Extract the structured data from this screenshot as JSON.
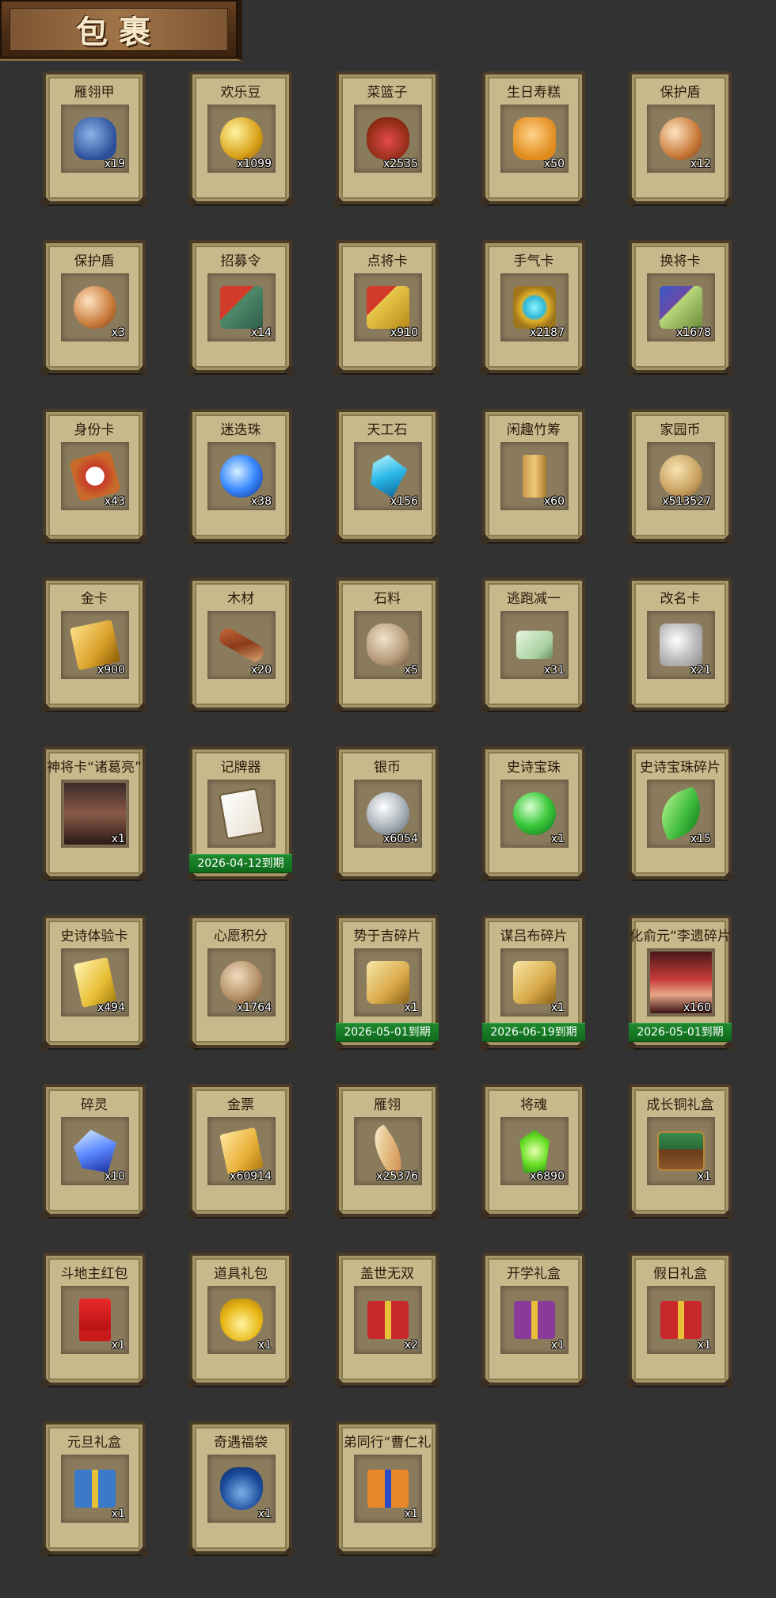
{
  "header": {
    "title": "包裹"
  },
  "items": [
    {
      "name": "雁翎甲",
      "qty": "x19",
      "icon": "armor-icon",
      "style": "i-armor",
      "expiry": ""
    },
    {
      "name": "欢乐豆",
      "qty": "x1099",
      "icon": "gold-beans-icon",
      "style": "i-coin",
      "expiry": ""
    },
    {
      "name": "菜篮子",
      "qty": "x2535",
      "icon": "vegetable-basket-icon",
      "style": "i-basket",
      "expiry": ""
    },
    {
      "name": "生日寿糕",
      "qty": "x50",
      "icon": "birthday-cake-icon",
      "style": "i-cake",
      "expiry": ""
    },
    {
      "name": "保护盾",
      "qty": "x12",
      "icon": "shield-icon",
      "style": "i-shield",
      "expiry": ""
    },
    {
      "name": "保护盾",
      "qty": "x3",
      "icon": "shield-icon",
      "style": "i-shield",
      "expiry": ""
    },
    {
      "name": "招募令",
      "qty": "x14",
      "icon": "recruit-order-icon",
      "style": "i-flag-red",
      "expiry": ""
    },
    {
      "name": "点将卡",
      "qty": "x910",
      "icon": "general-card-icon",
      "style": "i-ticket",
      "expiry": ""
    },
    {
      "name": "手气卡",
      "qty": "x2187",
      "icon": "luck-card-icon",
      "style": "i-ring",
      "expiry": ""
    },
    {
      "name": "换将卡",
      "qty": "x1678",
      "icon": "swap-card-icon",
      "style": "i-swap",
      "expiry": ""
    },
    {
      "name": "身份卡",
      "qty": "x43",
      "icon": "identity-card-icon",
      "style": "i-mask",
      "expiry": ""
    },
    {
      "name": "迷迭珠",
      "qty": "x38",
      "icon": "blue-orb-icon",
      "style": "i-orb-blue",
      "expiry": ""
    },
    {
      "name": "天工石",
      "qty": "x156",
      "icon": "cyan-crystal-icon",
      "style": "i-crystal-cyan",
      "expiry": ""
    },
    {
      "name": "闲趣竹筹",
      "qty": "x60",
      "icon": "bamboo-tally-icon",
      "style": "i-bamboo",
      "expiry": ""
    },
    {
      "name": "家园币",
      "qty": "x513527",
      "icon": "home-coin-icon",
      "style": "i-token",
      "expiry": ""
    },
    {
      "name": "金卡",
      "qty": "x900",
      "icon": "gold-card-icon",
      "style": "i-gold-card",
      "expiry": ""
    },
    {
      "name": "木材",
      "qty": "x20",
      "icon": "wood-icon",
      "style": "i-wood",
      "expiry": ""
    },
    {
      "name": "石料",
      "qty": "x5",
      "icon": "stone-icon",
      "style": "i-stone",
      "expiry": ""
    },
    {
      "name": "逃跑减一",
      "qty": "x31",
      "icon": "jade-tag-icon",
      "style": "i-jade-tag",
      "expiry": ""
    },
    {
      "name": "改名卡",
      "qty": "x21",
      "icon": "rename-card-icon",
      "style": "i-rename",
      "expiry": ""
    },
    {
      "name": "神将卡“诸葛亮”",
      "qty": "x1",
      "icon": "hero-portrait-icon",
      "style": "i-portrait",
      "expiry": ""
    },
    {
      "name": "记牌器",
      "qty": "",
      "icon": "card-counter-icon",
      "style": "i-cards",
      "expiry": "2026-04-12到期"
    },
    {
      "name": "银币",
      "qty": "x6054",
      "icon": "silver-coin-icon",
      "style": "i-silver",
      "expiry": ""
    },
    {
      "name": "史诗宝珠",
      "qty": "x1",
      "icon": "green-orb-icon",
      "style": "i-orb-green",
      "expiry": ""
    },
    {
      "name": "史诗宝珠碎片",
      "qty": "x15",
      "icon": "green-shard-icon",
      "style": "i-leaf-green",
      "expiry": ""
    },
    {
      "name": "史诗体验卡",
      "qty": "x494",
      "icon": "gold-experience-card-icon",
      "style": "i-gold-scroll",
      "expiry": ""
    },
    {
      "name": "心愿积分",
      "qty": "x1764",
      "icon": "heart-coin-icon",
      "style": "i-heart-coin",
      "expiry": ""
    },
    {
      "name": "势于吉碎片",
      "qty": "x1",
      "icon": "puzzle-piece-icon",
      "style": "i-puzzle",
      "expiry": "2026-05-01到期"
    },
    {
      "name": "谋吕布碎片",
      "qty": "x1",
      "icon": "puzzle-piece-icon",
      "style": "i-puzzle",
      "expiry": "2026-06-19到期"
    },
    {
      "name": "化俞元“李遗碎片",
      "qty": "x160",
      "icon": "hero-portrait-icon",
      "style": "i-hero-red",
      "expiry": "2026-05-01到期"
    },
    {
      "name": "碎灵",
      "qty": "x10",
      "icon": "blue-crystal-icon",
      "style": "i-crystal-blue",
      "expiry": ""
    },
    {
      "name": "金票",
      "qty": "x60914",
      "icon": "gold-ticket-icon",
      "style": "i-gold-note",
      "expiry": ""
    },
    {
      "name": "雁翎",
      "qty": "x25376",
      "icon": "feather-icon",
      "style": "i-feather",
      "expiry": ""
    },
    {
      "name": "将魂",
      "qty": "x6890",
      "icon": "green-soul-icon",
      "style": "i-soul",
      "expiry": ""
    },
    {
      "name": "成长铜礼盒",
      "qty": "x1",
      "icon": "treasure-chest-icon",
      "style": "i-chest",
      "expiry": ""
    },
    {
      "name": "斗地主红包",
      "qty": "x1",
      "icon": "red-packet-icon",
      "style": "i-redpacket",
      "expiry": ""
    },
    {
      "name": "道具礼包",
      "qty": "x1",
      "icon": "gold-bag-icon",
      "style": "i-bag",
      "expiry": ""
    },
    {
      "name": "盖世无双",
      "qty": "x2",
      "icon": "gift-box-icon",
      "style": "i-gift-red",
      "expiry": ""
    },
    {
      "name": "开学礼盒",
      "qty": "x1",
      "icon": "gift-box-icon",
      "style": "i-gift-purple",
      "expiry": ""
    },
    {
      "name": "假日礼盒",
      "qty": "x1",
      "icon": "gift-box-icon",
      "style": "i-gift-red",
      "expiry": ""
    },
    {
      "name": "元旦礼盒",
      "qty": "x1",
      "icon": "gift-box-icon",
      "style": "i-gift-blue",
      "expiry": ""
    },
    {
      "name": "奇遇福袋",
      "qty": "x1",
      "icon": "lucky-bag-icon",
      "style": "i-bag-blue",
      "expiry": ""
    },
    {
      "name": "弟同行“曹仁礼",
      "qty": "x1",
      "icon": "gift-box-icon",
      "style": "i-gift-orange",
      "expiry": ""
    }
  ]
}
